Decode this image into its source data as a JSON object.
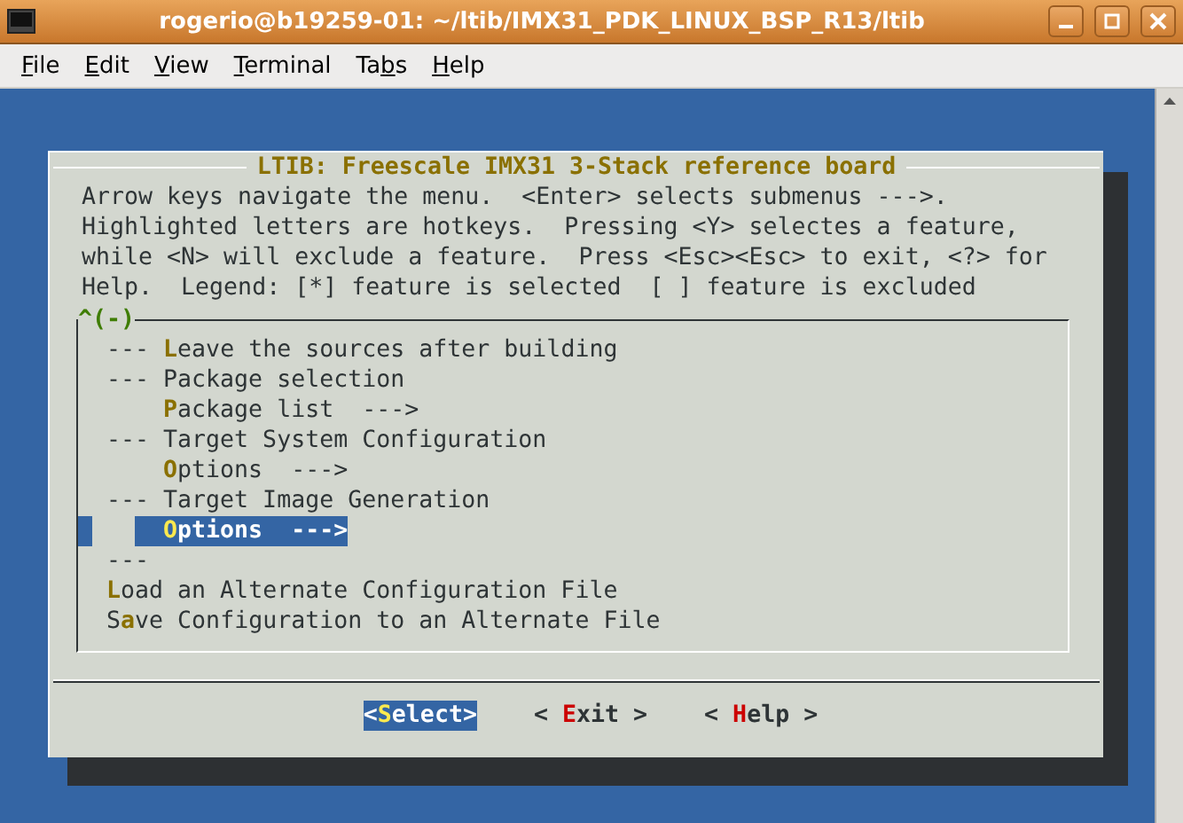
{
  "window": {
    "title": "rogerio@b19259-01: ~/ltib/IMX31_PDK_LINUX_BSP_R13/ltib"
  },
  "menu": [
    {
      "mnemonic": "F",
      "after": "ile"
    },
    {
      "mnemonic": "E",
      "after": "dit"
    },
    {
      "mnemonic": "V",
      "after": "iew"
    },
    {
      "mnemonic": "T",
      "after": "erminal"
    },
    {
      "before": "Ta",
      "mnemonic": "b",
      "after": "s"
    },
    {
      "mnemonic": "H",
      "after": "elp"
    }
  ],
  "dialog": {
    "title": "LTIB: Freescale IMX31 3-Stack reference board",
    "help_lines": [
      "Arrow keys navigate the menu.  <Enter> selects submenus --->.",
      "Highlighted letters are hotkeys.  Pressing <Y> selectes a feature,",
      "while <N> will exclude a feature.  Press <Esc><Esc> to exit, <?> for",
      "Help.  Legend: [*] feature is selected  [ ] feature is excluded"
    ],
    "scroll_indicator": "^(-)",
    "items": [
      {
        "indented": false,
        "before": "--- ",
        "hotkey": "L",
        "after": "eave the sources after building",
        "selected": false
      },
      {
        "indented": false,
        "before": "--- Package selection",
        "selected": false
      },
      {
        "indented": true,
        "hotkey": "P",
        "after": "ackage list  --->",
        "selected": false
      },
      {
        "indented": false,
        "before": "--- Target System Configuration",
        "selected": false
      },
      {
        "indented": true,
        "hotkey": "O",
        "after": "ptions  --->",
        "selected": false
      },
      {
        "indented": false,
        "before": "--- Target Image Generation",
        "selected": false
      },
      {
        "indented": true,
        "hotkey": "O",
        "after": "ptions  --->",
        "selected": true
      },
      {
        "indented": false,
        "before": "---",
        "selected": false
      },
      {
        "indented": false,
        "hotkey": "L",
        "after": "oad an Alternate Configuration File",
        "selected": false
      },
      {
        "indented": false,
        "before": "S",
        "hotkey": "a",
        "after": "ve Configuration to an Alternate File",
        "selected": false
      }
    ],
    "buttons": [
      {
        "before": "<",
        "hotkey": "S",
        "after": "elect>",
        "selected": true
      },
      {
        "before": "< ",
        "hotkey": "E",
        "after": "xit >",
        "selected": false
      },
      {
        "before": "< ",
        "hotkey": "H",
        "after": "elp >",
        "selected": false
      }
    ]
  }
}
